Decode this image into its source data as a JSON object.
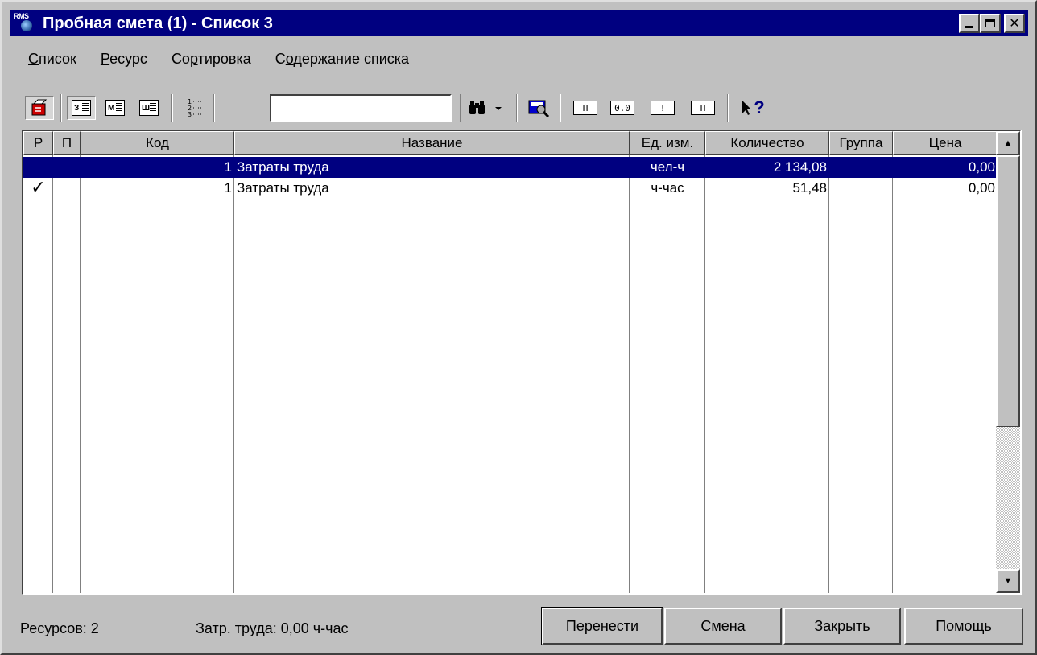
{
  "window": {
    "app_icon_text": "RMS",
    "title": "Пробная смета (1) - Список 3"
  },
  "menu": [
    {
      "pre": "",
      "u": "С",
      "post": "писок"
    },
    {
      "pre": "",
      "u": "Р",
      "post": "есурс"
    },
    {
      "pre": "Со",
      "u": "р",
      "post": "тировка"
    },
    {
      "pre": "С",
      "u": "о",
      "post": "держание списка"
    }
  ],
  "toolbar": {
    "view_buttons": [
      "З",
      "М",
      "Ш"
    ],
    "search_value": "",
    "small_buttons": [
      "П",
      "0.0",
      "!",
      "П"
    ],
    "help_text": "?"
  },
  "table": {
    "columns": [
      "Р",
      "П",
      "Код",
      "Название",
      "Ед. изм.",
      "Количество",
      "Группа",
      "Цена"
    ],
    "rows": [
      {
        "r": "",
        "p": "",
        "code": "1",
        "name": "Затраты труда",
        "unit": "чел-ч",
        "qty": "2 134,08",
        "group": "",
        "price": "0,00",
        "selected": true
      },
      {
        "r": "✓",
        "p": "",
        "code": "1",
        "name": "Затраты труда",
        "unit": "ч-час",
        "qty": "51,48",
        "group": "",
        "price": "0,00",
        "selected": false
      }
    ]
  },
  "status": {
    "resources": "Ресурсов: 2",
    "labor": "Затр. труда: 0,00 ч-час"
  },
  "buttons": [
    {
      "u": "П",
      "post": "еренести"
    },
    {
      "u": "С",
      "post": "мена"
    },
    {
      "pre": "За",
      "u": "к",
      "post": "рыть"
    },
    {
      "u": "П",
      "post": "омощь"
    }
  ],
  "scrollbar": {
    "up": "▲",
    "down": "▼"
  }
}
